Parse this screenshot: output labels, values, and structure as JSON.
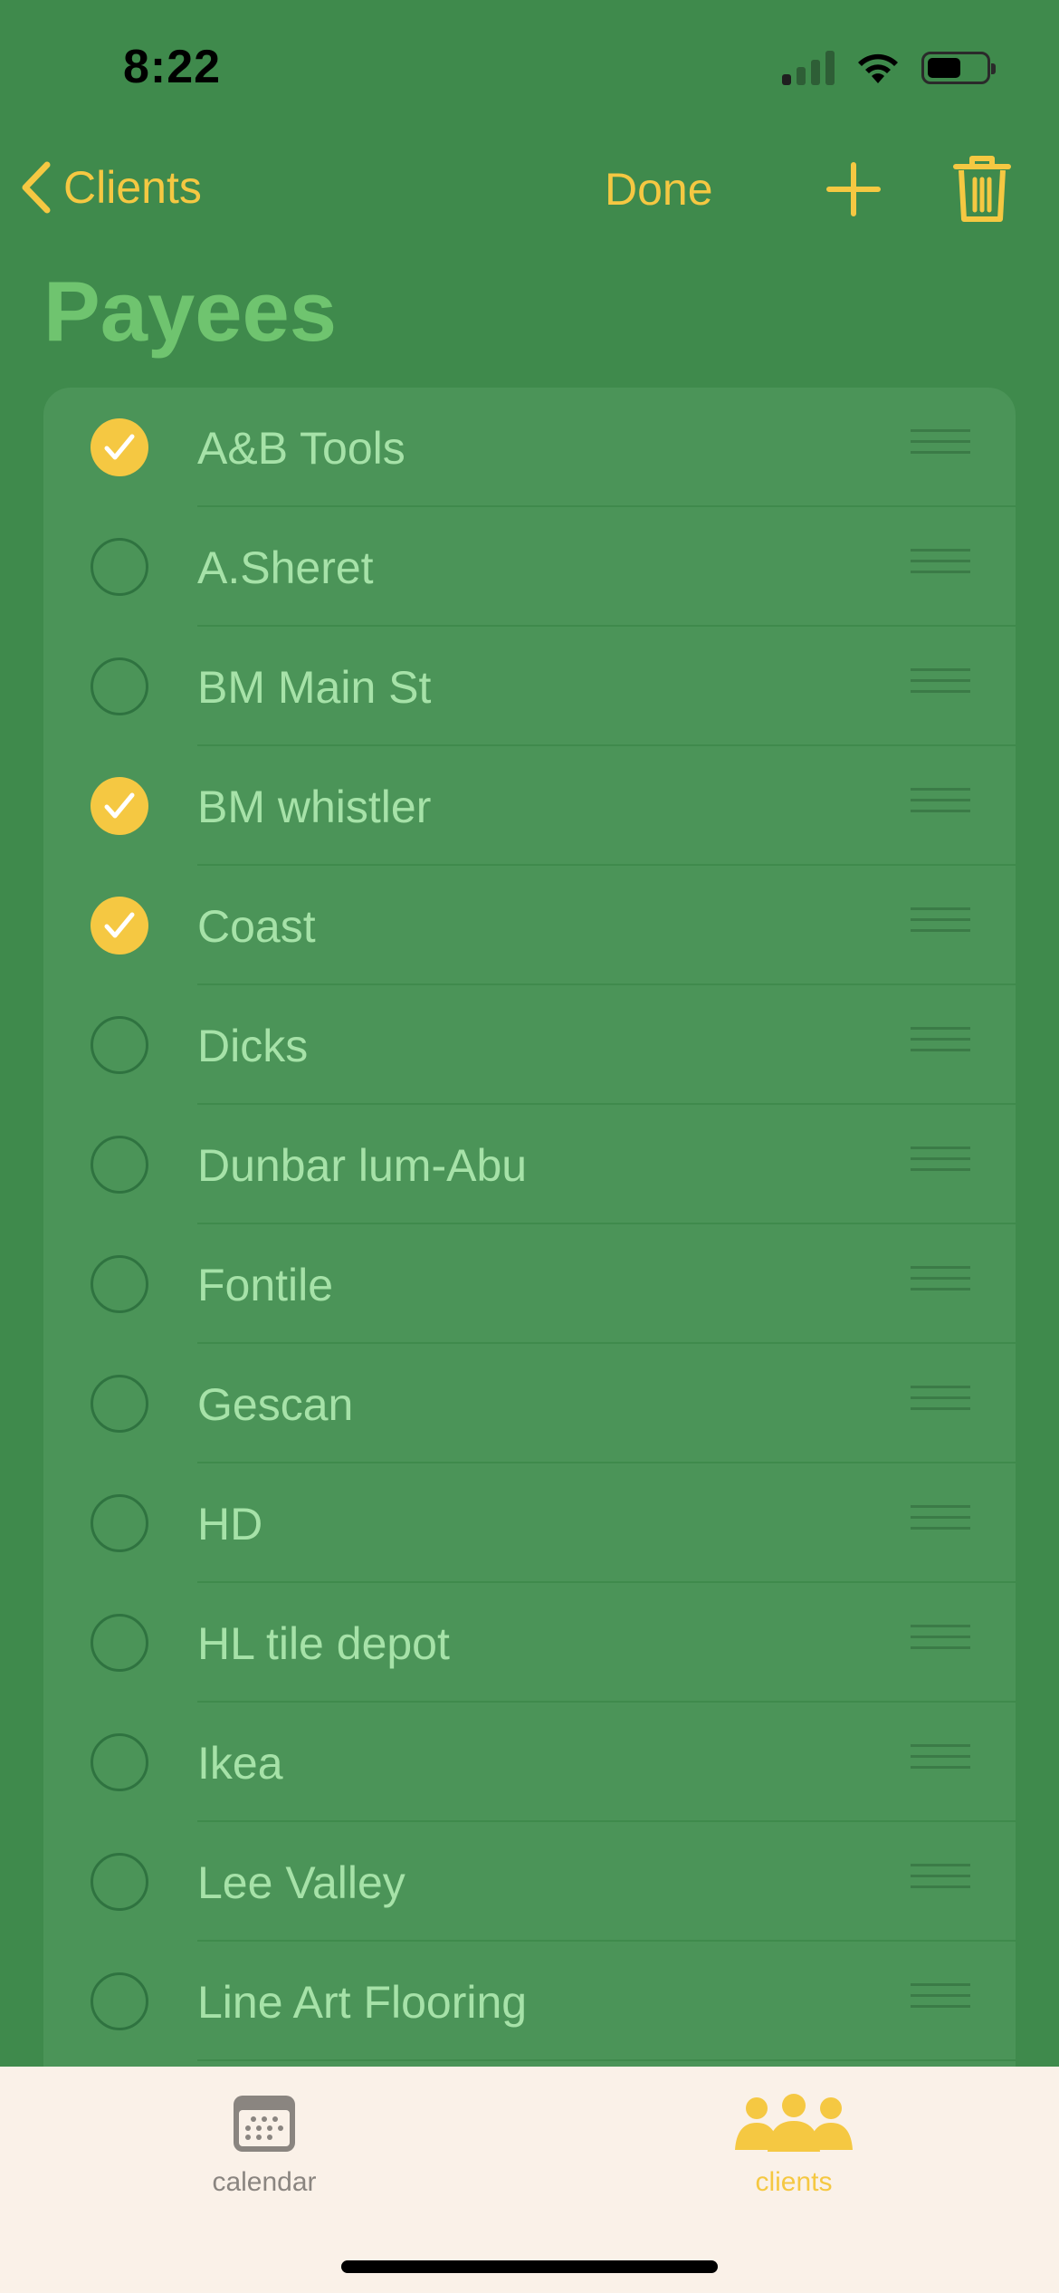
{
  "status_bar": {
    "time": "8:22"
  },
  "nav": {
    "back_label": "Clients",
    "done_label": "Done"
  },
  "page_title": "Payees",
  "payees": [
    {
      "name": "A&B Tools",
      "checked": true
    },
    {
      "name": "A.Sheret",
      "checked": false
    },
    {
      "name": "BM Main St",
      "checked": false
    },
    {
      "name": "BM whistler",
      "checked": true
    },
    {
      "name": "Coast",
      "checked": true
    },
    {
      "name": "Dicks",
      "checked": false
    },
    {
      "name": "Dunbar lum-Abu",
      "checked": false
    },
    {
      "name": "Fontile",
      "checked": false
    },
    {
      "name": "Gescan",
      "checked": false
    },
    {
      "name": "HD",
      "checked": false
    },
    {
      "name": "HL tile depot",
      "checked": false
    },
    {
      "name": "Ikea",
      "checked": false
    },
    {
      "name": "Lee Valley",
      "checked": false
    },
    {
      "name": "Line Art Flooring",
      "checked": false
    }
  ],
  "tab_bar": {
    "tabs": [
      {
        "label": "calendar",
        "icon": "calendar-icon",
        "active": false
      },
      {
        "label": "clients",
        "icon": "people-icon",
        "active": true
      }
    ]
  },
  "colors": {
    "background": "#3f8a4c",
    "card": "#4b9458",
    "accent": "#f5c842",
    "title": "#6fc46f",
    "row_text": "#a6e2a8",
    "tab_bar": "#faf1e8",
    "tab_inactive": "#8a8580"
  }
}
